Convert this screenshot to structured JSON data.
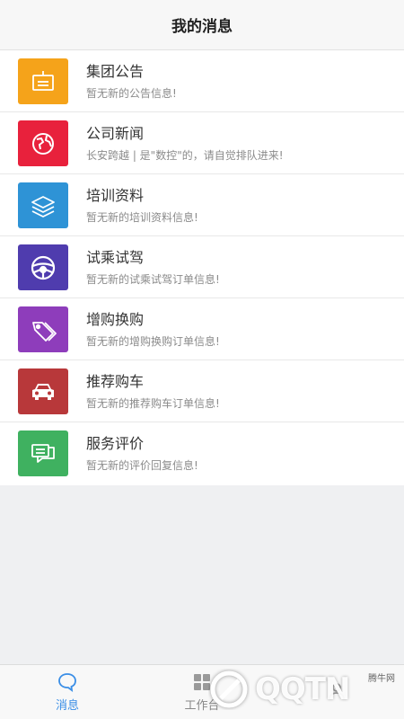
{
  "header": {
    "title": "我的消息"
  },
  "items": [
    {
      "title": "集团公告",
      "subtitle": "暂无新的公告信息!",
      "color": "#f5a31a",
      "icon": "announcement-board-icon"
    },
    {
      "title": "公司新闻",
      "subtitle": "长安跨越 | 是\"数控\"的，请自觉排队进来!",
      "color": "#e8213c",
      "icon": "globe-icon"
    },
    {
      "title": "培训资料",
      "subtitle": "暂无新的培训资料信息!",
      "color": "#2e93d6",
      "icon": "layers-icon"
    },
    {
      "title": "试乘试驾",
      "subtitle": "暂无新的试乘试驾订单信息!",
      "color": "#4f3cae",
      "icon": "steering-wheel-icon"
    },
    {
      "title": "增购换购",
      "subtitle": "暂无新的增购换购订单信息!",
      "color": "#8e3dbb",
      "icon": "price-tags-icon"
    },
    {
      "title": "推荐购车",
      "subtitle": "暂无新的推荐购车订单信息!",
      "color": "#b8383a",
      "icon": "car-icon"
    },
    {
      "title": "服务评价",
      "subtitle": "暂无新的评价回复信息!",
      "color": "#3fb160",
      "icon": "chat-bubbles-icon"
    }
  ],
  "tabs": [
    {
      "label": "消息",
      "icon": "message-bubble-icon",
      "active": true,
      "color": "#3a8ee6"
    },
    {
      "label": "工作台",
      "icon": "grid-icon",
      "active": false,
      "color": "#888888"
    },
    {
      "label": "",
      "icon": "person-icon",
      "active": false,
      "color": "#888888"
    }
  ],
  "watermark": {
    "text": "QQTN",
    "small": "腾牛网"
  }
}
